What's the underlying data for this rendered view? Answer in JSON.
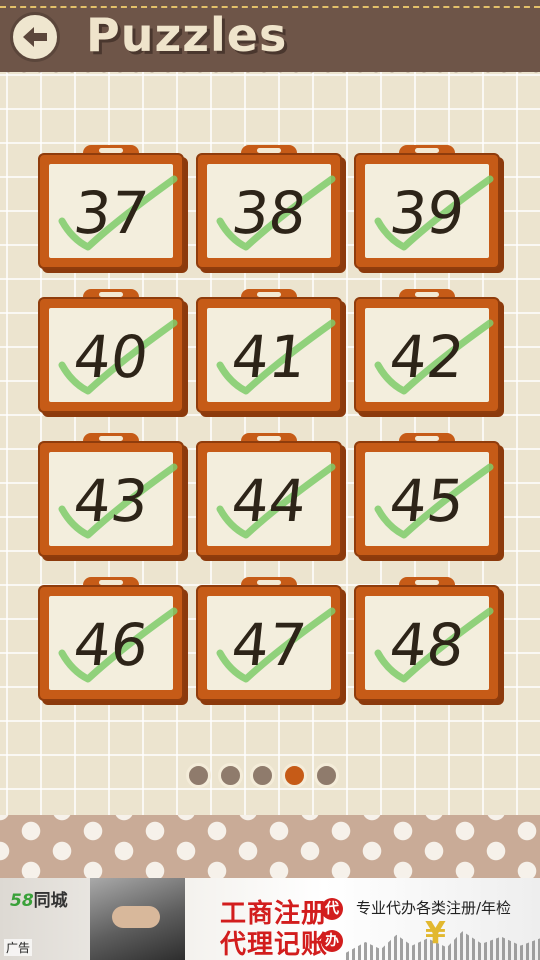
{
  "header": {
    "title": "Puzzles",
    "back_icon": "back-arrow-icon"
  },
  "puzzles": [
    {
      "number": "37",
      "completed": true
    },
    {
      "number": "38",
      "completed": true
    },
    {
      "number": "39",
      "completed": true
    },
    {
      "number": "40",
      "completed": true
    },
    {
      "number": "41",
      "completed": true
    },
    {
      "number": "42",
      "completed": true
    },
    {
      "number": "43",
      "completed": true
    },
    {
      "number": "44",
      "completed": true
    },
    {
      "number": "45",
      "completed": true
    },
    {
      "number": "46",
      "completed": true
    },
    {
      "number": "47",
      "completed": true
    },
    {
      "number": "48",
      "completed": true
    }
  ],
  "pagination": {
    "pages": 5,
    "current": 4
  },
  "ad": {
    "brand_num": "58",
    "brand_text": "同城",
    "tag": "广告",
    "headline1": "工商注册",
    "headline1_badge": "代",
    "headline2": "代理记账",
    "headline2_badge": "办",
    "description": "专业代办各类注册/年检",
    "currency_symbol": "¥"
  },
  "colors": {
    "accent": "#c65b17",
    "header_bg": "#6e5548",
    "check": "#7ecb6a"
  }
}
